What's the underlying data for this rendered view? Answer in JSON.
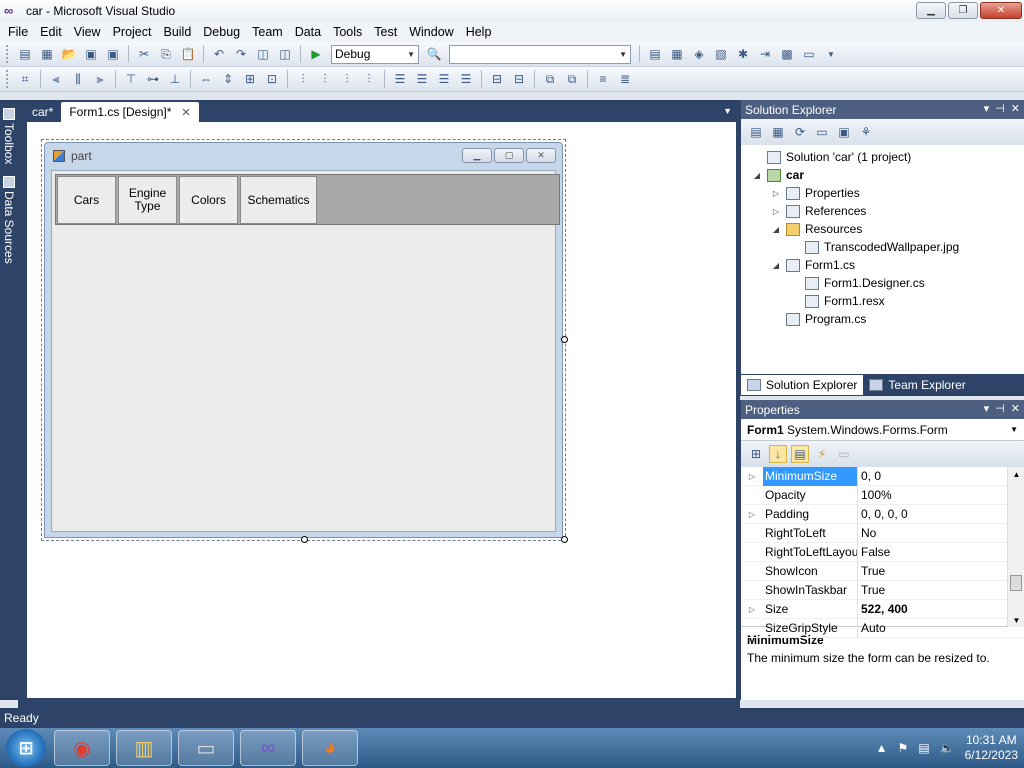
{
  "window": {
    "title": "car - Microsoft Visual Studio"
  },
  "menu": [
    "File",
    "Edit",
    "View",
    "Project",
    "Build",
    "Debug",
    "Team",
    "Data",
    "Tools",
    "Test",
    "Window",
    "Help"
  ],
  "toolbar": {
    "config_value": "Debug",
    "platform_value": ""
  },
  "left_tabs": {
    "toolbox": "Toolbox",
    "data_sources": "Data Sources"
  },
  "doc_tabs": [
    {
      "label": "car*",
      "active": false
    },
    {
      "label": "Form1.cs [Design]*",
      "active": true
    }
  ],
  "form": {
    "title": "part",
    "buttons": [
      {
        "label": "Cars"
      },
      {
        "label": "Engine Type"
      },
      {
        "label": "Colors"
      },
      {
        "label": "Schematics"
      }
    ]
  },
  "solution_explorer": {
    "title": "Solution Explorer",
    "tree": [
      {
        "label": "Solution 'car' (1 project)",
        "level": 0,
        "expander": "",
        "icon": "solution-icon"
      },
      {
        "label": "car",
        "level": 0,
        "expander": "◢",
        "icon": "project-icon",
        "bold": true
      },
      {
        "label": "Properties",
        "level": 1,
        "expander": "▷",
        "icon": "properties-icon"
      },
      {
        "label": "References",
        "level": 1,
        "expander": "▷",
        "icon": "references-icon"
      },
      {
        "label": "Resources",
        "level": 1,
        "expander": "◢",
        "icon": "folder-icon"
      },
      {
        "label": "TranscodedWallpaper.jpg",
        "level": 2,
        "expander": "",
        "icon": "image-file-icon"
      },
      {
        "label": "Form1.cs",
        "level": 1,
        "expander": "◢",
        "icon": "form-icon"
      },
      {
        "label": "Form1.Designer.cs",
        "level": 2,
        "expander": "",
        "icon": "cs-file-icon"
      },
      {
        "label": "Form1.resx",
        "level": 2,
        "expander": "",
        "icon": "resx-file-icon"
      },
      {
        "label": "Program.cs",
        "level": 1,
        "expander": "",
        "icon": "cs-file-icon"
      }
    ],
    "tabs": [
      "Solution Explorer",
      "Team Explorer"
    ]
  },
  "properties": {
    "title": "Properties",
    "object_name": "Form1",
    "object_type": "System.Windows.Forms.Form",
    "rows": [
      {
        "name": "MinimumSize",
        "value": "0, 0",
        "expander": "▷",
        "selected": true,
        "bold": false
      },
      {
        "name": "Opacity",
        "value": "100%",
        "expander": "",
        "selected": false,
        "bold": false
      },
      {
        "name": "Padding",
        "value": "0, 0, 0, 0",
        "expander": "▷",
        "selected": false,
        "bold": false
      },
      {
        "name": "RightToLeft",
        "value": "No",
        "expander": "",
        "selected": false,
        "bold": false
      },
      {
        "name": "RightToLeftLayout",
        "value": "False",
        "expander": "",
        "selected": false,
        "bold": false
      },
      {
        "name": "ShowIcon",
        "value": "True",
        "expander": "",
        "selected": false,
        "bold": false
      },
      {
        "name": "ShowInTaskbar",
        "value": "True",
        "expander": "",
        "selected": false,
        "bold": false
      },
      {
        "name": "Size",
        "value": "522, 400",
        "expander": "▷",
        "selected": false,
        "bold": true
      },
      {
        "name": "SizeGripStyle",
        "value": "Auto",
        "expander": "",
        "selected": false,
        "bold": false
      }
    ],
    "description_title": "MinimumSize",
    "description_text": "The minimum size the form can be resized to."
  },
  "status": {
    "text": "Ready"
  },
  "taskbar": {
    "apps": [
      "chrome-icon",
      "file-explorer-icon",
      "scanner-icon",
      "visual-studio-icon",
      "firefox-icon"
    ],
    "time": "10:31 AM",
    "date": "6/12/2023"
  }
}
